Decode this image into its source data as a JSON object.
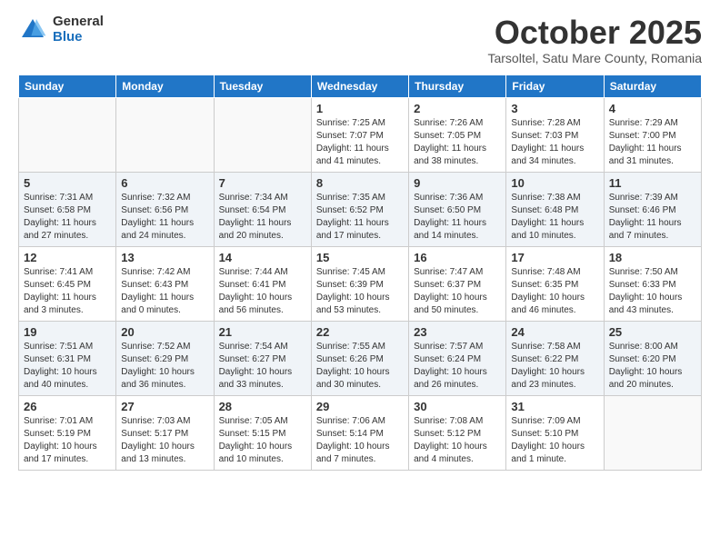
{
  "logo": {
    "general": "General",
    "blue": "Blue"
  },
  "title": "October 2025",
  "subtitle": "Tarsoltel, Satu Mare County, Romania",
  "weekdays": [
    "Sunday",
    "Monday",
    "Tuesday",
    "Wednesday",
    "Thursday",
    "Friday",
    "Saturday"
  ],
  "weeks": [
    [
      {
        "day": "",
        "info": ""
      },
      {
        "day": "",
        "info": ""
      },
      {
        "day": "",
        "info": ""
      },
      {
        "day": "1",
        "info": "Sunrise: 7:25 AM\nSunset: 7:07 PM\nDaylight: 11 hours and 41 minutes."
      },
      {
        "day": "2",
        "info": "Sunrise: 7:26 AM\nSunset: 7:05 PM\nDaylight: 11 hours and 38 minutes."
      },
      {
        "day": "3",
        "info": "Sunrise: 7:28 AM\nSunset: 7:03 PM\nDaylight: 11 hours and 34 minutes."
      },
      {
        "day": "4",
        "info": "Sunrise: 7:29 AM\nSunset: 7:00 PM\nDaylight: 11 hours and 31 minutes."
      }
    ],
    [
      {
        "day": "5",
        "info": "Sunrise: 7:31 AM\nSunset: 6:58 PM\nDaylight: 11 hours and 27 minutes."
      },
      {
        "day": "6",
        "info": "Sunrise: 7:32 AM\nSunset: 6:56 PM\nDaylight: 11 hours and 24 minutes."
      },
      {
        "day": "7",
        "info": "Sunrise: 7:34 AM\nSunset: 6:54 PM\nDaylight: 11 hours and 20 minutes."
      },
      {
        "day": "8",
        "info": "Sunrise: 7:35 AM\nSunset: 6:52 PM\nDaylight: 11 hours and 17 minutes."
      },
      {
        "day": "9",
        "info": "Sunrise: 7:36 AM\nSunset: 6:50 PM\nDaylight: 11 hours and 14 minutes."
      },
      {
        "day": "10",
        "info": "Sunrise: 7:38 AM\nSunset: 6:48 PM\nDaylight: 11 hours and 10 minutes."
      },
      {
        "day": "11",
        "info": "Sunrise: 7:39 AM\nSunset: 6:46 PM\nDaylight: 11 hours and 7 minutes."
      }
    ],
    [
      {
        "day": "12",
        "info": "Sunrise: 7:41 AM\nSunset: 6:45 PM\nDaylight: 11 hours and 3 minutes."
      },
      {
        "day": "13",
        "info": "Sunrise: 7:42 AM\nSunset: 6:43 PM\nDaylight: 11 hours and 0 minutes."
      },
      {
        "day": "14",
        "info": "Sunrise: 7:44 AM\nSunset: 6:41 PM\nDaylight: 10 hours and 56 minutes."
      },
      {
        "day": "15",
        "info": "Sunrise: 7:45 AM\nSunset: 6:39 PM\nDaylight: 10 hours and 53 minutes."
      },
      {
        "day": "16",
        "info": "Sunrise: 7:47 AM\nSunset: 6:37 PM\nDaylight: 10 hours and 50 minutes."
      },
      {
        "day": "17",
        "info": "Sunrise: 7:48 AM\nSunset: 6:35 PM\nDaylight: 10 hours and 46 minutes."
      },
      {
        "day": "18",
        "info": "Sunrise: 7:50 AM\nSunset: 6:33 PM\nDaylight: 10 hours and 43 minutes."
      }
    ],
    [
      {
        "day": "19",
        "info": "Sunrise: 7:51 AM\nSunset: 6:31 PM\nDaylight: 10 hours and 40 minutes."
      },
      {
        "day": "20",
        "info": "Sunrise: 7:52 AM\nSunset: 6:29 PM\nDaylight: 10 hours and 36 minutes."
      },
      {
        "day": "21",
        "info": "Sunrise: 7:54 AM\nSunset: 6:27 PM\nDaylight: 10 hours and 33 minutes."
      },
      {
        "day": "22",
        "info": "Sunrise: 7:55 AM\nSunset: 6:26 PM\nDaylight: 10 hours and 30 minutes."
      },
      {
        "day": "23",
        "info": "Sunrise: 7:57 AM\nSunset: 6:24 PM\nDaylight: 10 hours and 26 minutes."
      },
      {
        "day": "24",
        "info": "Sunrise: 7:58 AM\nSunset: 6:22 PM\nDaylight: 10 hours and 23 minutes."
      },
      {
        "day": "25",
        "info": "Sunrise: 8:00 AM\nSunset: 6:20 PM\nDaylight: 10 hours and 20 minutes."
      }
    ],
    [
      {
        "day": "26",
        "info": "Sunrise: 7:01 AM\nSunset: 5:19 PM\nDaylight: 10 hours and 17 minutes."
      },
      {
        "day": "27",
        "info": "Sunrise: 7:03 AM\nSunset: 5:17 PM\nDaylight: 10 hours and 13 minutes."
      },
      {
        "day": "28",
        "info": "Sunrise: 7:05 AM\nSunset: 5:15 PM\nDaylight: 10 hours and 10 minutes."
      },
      {
        "day": "29",
        "info": "Sunrise: 7:06 AM\nSunset: 5:14 PM\nDaylight: 10 hours and 7 minutes."
      },
      {
        "day": "30",
        "info": "Sunrise: 7:08 AM\nSunset: 5:12 PM\nDaylight: 10 hours and 4 minutes."
      },
      {
        "day": "31",
        "info": "Sunrise: 7:09 AM\nSunset: 5:10 PM\nDaylight: 10 hours and 1 minute."
      },
      {
        "day": "",
        "info": ""
      }
    ]
  ]
}
